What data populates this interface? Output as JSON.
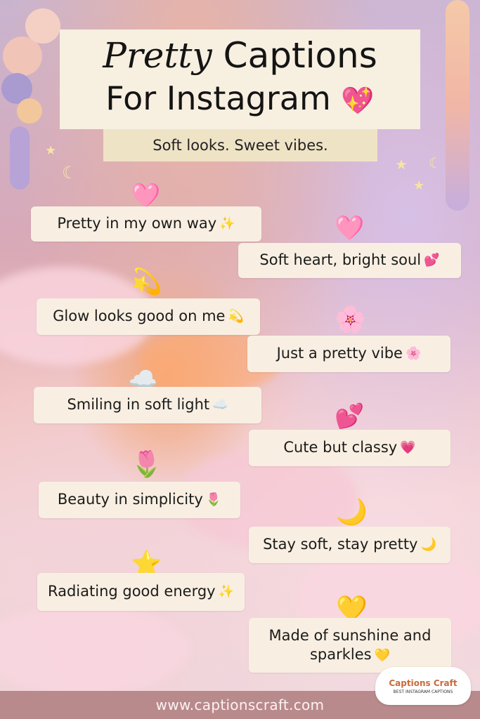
{
  "header": {
    "title_script": "Pretty",
    "title_rest": " Captions",
    "title_line2": "For Instagram",
    "title_emoji": "💖",
    "subtitle": "Soft looks. Sweet vibes."
  },
  "captions": [
    {
      "text": "Pretty in my own way",
      "emoji": "✨",
      "deco": "🩷"
    },
    {
      "text": "Soft heart, bright soul",
      "emoji": "💕",
      "deco": "🩷"
    },
    {
      "text": "Glow looks good on me",
      "emoji": "💫",
      "deco": "💫"
    },
    {
      "text": "Just a pretty vibe",
      "emoji": "🌸",
      "deco": "🌸"
    },
    {
      "text": "Smiling in soft light",
      "emoji": "☁️",
      "deco": "☁️"
    },
    {
      "text": "Cute but classy",
      "emoji": "💗",
      "deco": "💕"
    },
    {
      "text": "Beauty in simplicity",
      "emoji": "🌷",
      "deco": "🌷"
    },
    {
      "text": "Stay soft, stay pretty",
      "emoji": "🌙",
      "deco": "🌙"
    },
    {
      "text": "Radiating good energy",
      "emoji": "✨",
      "deco": "⭐"
    },
    {
      "text": "Made of sunshine and sparkles",
      "emoji": "💛",
      "deco": "💛"
    }
  ],
  "logo": {
    "name": "Captions Craft",
    "tagline": "BEST INSTAGRAM CAPTIONS"
  },
  "footer": {
    "url": "www.captionscraft.com"
  }
}
